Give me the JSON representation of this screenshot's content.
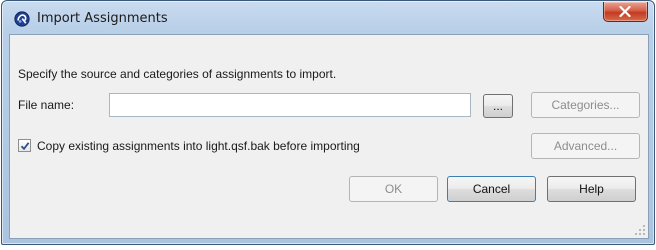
{
  "window": {
    "title": "Import Assignments",
    "app_icon": "quartus-logo-icon",
    "close_icon": "close-icon"
  },
  "dialog": {
    "instructions": "Specify the source and categories of assignments to import.",
    "file_name_label": "File name:",
    "file_name_value": "",
    "browse_label": "...",
    "categories_label": "Categories...",
    "advanced_label": "Advanced...",
    "copy_checkbox_label": "Copy existing assignments into light.qsf.bak before importing",
    "copy_checkbox_checked": true,
    "ok_label": "OK",
    "cancel_label": "Cancel",
    "help_label": "Help"
  },
  "colors": {
    "accent": "#3c7fb1",
    "titlebar": "#b8cfe8",
    "close_button": "#c23a22",
    "client_bg": "#f0f0f0"
  }
}
